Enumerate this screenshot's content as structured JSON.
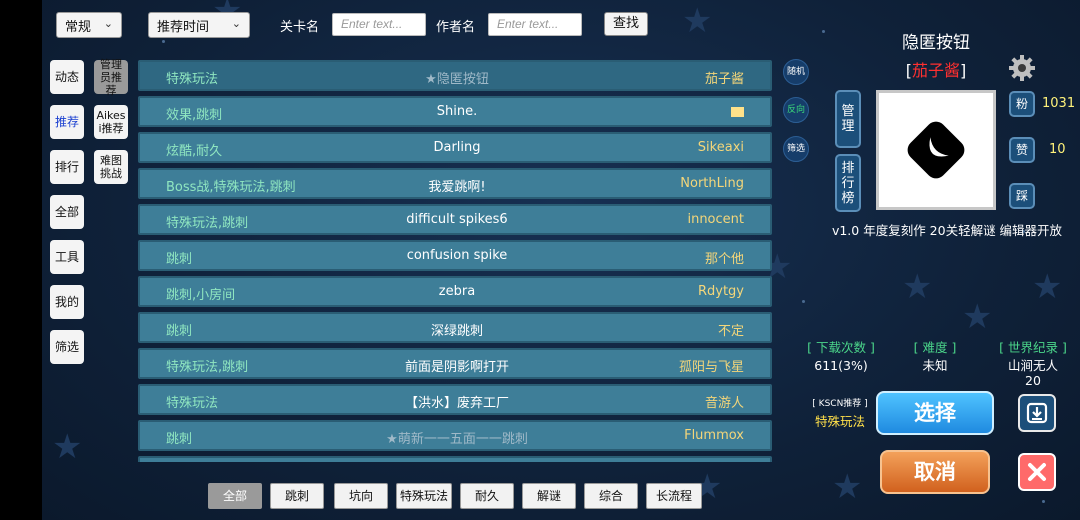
{
  "topbar": {
    "mode_select": "常规",
    "sort_select": "推荐时间",
    "level_name_label": "关卡名",
    "level_name_placeholder": "Enter text...",
    "author_label": "作者名",
    "author_placeholder": "Enter text...",
    "find_button": "查找"
  },
  "nav": {
    "left_col": [
      "动态",
      "推荐",
      "排行",
      "全部",
      "工具",
      "我的",
      "筛选"
    ],
    "right_col": [
      "管理员推荐",
      "Aikesi推荐",
      "难图挑战"
    ],
    "active": "推荐"
  },
  "levels": [
    {
      "tag": "特殊玩法",
      "name": "★隐匿按钮",
      "author": "茄子酱",
      "selected": true
    },
    {
      "tag": "效果,跳刺",
      "name": "Shine.",
      "author": "",
      "author_box": true
    },
    {
      "tag": "炫酷,耐久",
      "name": "Darling",
      "author": "Sikeaxi"
    },
    {
      "tag": "Boss战,特殊玩法,跳刺",
      "name": "我爱跳啊!",
      "author": "NorthLing"
    },
    {
      "tag": "特殊玩法,跳刺",
      "name": "difficult spikes6",
      "author": "innocent"
    },
    {
      "tag": "跳刺",
      "name": "confusion spike",
      "author": "那个他"
    },
    {
      "tag": "跳刺,小房间",
      "name": "zebra",
      "author": "Rdytgy"
    },
    {
      "tag": "跳刺",
      "name": "深绿跳刺",
      "author": "不定"
    },
    {
      "tag": "特殊玩法,跳刺",
      "name": "前面是阴影啊打开",
      "author": "孤阳与飞星"
    },
    {
      "tag": "特殊玩法",
      "name": "【洪水】废弃工厂",
      "author": "音游人"
    },
    {
      "tag": "跳刺",
      "name": "★萌新一一五面一一跳刺",
      "author": "Flummox"
    }
  ],
  "side_round": {
    "random": "随机",
    "reverse": "反向",
    "filter": "筛选"
  },
  "detail": {
    "title": "隐匿按钮",
    "author": "茄子酱",
    "manage_button": "管理",
    "rank_button": "排行榜",
    "fans_label": "粉",
    "fans_count": "1031",
    "like_label": "赞",
    "like_count": "10",
    "dislike_label": "踩",
    "description": "v1.0 年度复刻作 20关轻解谜 编辑器开放",
    "downloads_head": "[ 下载次数 ]",
    "downloads_val": "611(3%)",
    "difficulty_head": "[ 难度 ]",
    "difficulty_val": "未知",
    "record_head": "[ 世界纪录 ]",
    "record_val": "山涧无人",
    "record_num": "20",
    "kscn_label": "[ KSCN推荐 ]",
    "kscn_val": "特殊玩法",
    "select_button": "选择",
    "cancel_button": "取消"
  },
  "categories": [
    "全部",
    "跳刺",
    "坑向",
    "特殊玩法",
    "耐久",
    "解谜",
    "综合",
    "长流程"
  ],
  "active_category": "全部",
  "colors": {
    "row_bg": "#3e7e98",
    "tag_text": "#8fe6c0",
    "author_text": "#f4d67a",
    "accent_red": "#ff3030"
  },
  "icons": {
    "gear": "gear-icon",
    "download": "download-icon",
    "close": "close-icon",
    "chevron": "chevron-down-icon",
    "preview": "level-preview-icon"
  }
}
